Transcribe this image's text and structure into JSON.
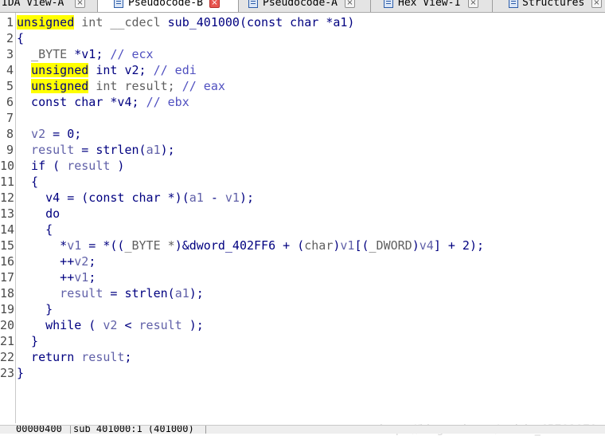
{
  "tabs": [
    {
      "label": "IDA View-A",
      "icon": "none",
      "close": "×",
      "active": false
    },
    {
      "label": "Pseudocode-B",
      "icon": "pseudocode-icon",
      "close": "×",
      "active": true
    },
    {
      "label": "Pseudocode-A",
      "icon": "pseudocode-icon",
      "close": "×",
      "active": false
    },
    {
      "label": "Hex View-1",
      "icon": "hex-icon",
      "close": "×",
      "active": false
    },
    {
      "label": "Structures",
      "icon": "struct-icon",
      "close": "×",
      "active": false
    }
  ],
  "code": {
    "lines": [
      {
        "n": "1",
        "tokens": [
          [
            "hl",
            "unsigned"
          ],
          [
            "typ",
            " int __cdecl "
          ],
          [
            "def",
            "sub_401000(const char *a1)"
          ]
        ]
      },
      {
        "n": "2",
        "tokens": [
          [
            "kw",
            "{"
          ]
        ]
      },
      {
        "n": "3",
        "tokens": [
          [
            "typ",
            "  _BYTE "
          ],
          [
            "kw",
            "*v1; "
          ],
          [
            "com",
            "// ecx"
          ]
        ]
      },
      {
        "n": "4",
        "tokens": [
          [
            "kw",
            "  "
          ],
          [
            "hl",
            "unsigned"
          ],
          [
            "kw",
            " int v2; "
          ],
          [
            "com",
            "// edi"
          ]
        ]
      },
      {
        "n": "5",
        "tokens": [
          [
            "kw",
            "  "
          ],
          [
            "hl",
            "unsigned"
          ],
          [
            "typ",
            " int result; "
          ],
          [
            "com",
            "// eax"
          ]
        ]
      },
      {
        "n": "6",
        "tokens": [
          [
            "kw",
            "  const char *v4; "
          ],
          [
            "com",
            "// ebx"
          ]
        ]
      },
      {
        "n": "7",
        "tokens": []
      },
      {
        "n": "8",
        "tokens": [
          [
            "var",
            "  v2"
          ],
          [
            "kw",
            " = 0;"
          ]
        ]
      },
      {
        "n": "9",
        "tokens": [
          [
            "var",
            "  result"
          ],
          [
            "kw",
            " = strlen("
          ],
          [
            "var",
            "a1"
          ],
          [
            "kw",
            ");"
          ]
        ]
      },
      {
        "n": "10",
        "tokens": [
          [
            "kw",
            "  if ( "
          ],
          [
            "var",
            "result"
          ],
          [
            "kw",
            " )"
          ]
        ]
      },
      {
        "n": "11",
        "tokens": [
          [
            "kw",
            "  {"
          ]
        ]
      },
      {
        "n": "12",
        "tokens": [
          [
            "kw",
            "    v4 = (const char *)("
          ],
          [
            "var",
            "a1"
          ],
          [
            "kw",
            " - "
          ],
          [
            "var",
            "v1"
          ],
          [
            "kw",
            ");"
          ]
        ]
      },
      {
        "n": "13",
        "tokens": [
          [
            "kw",
            "    do"
          ]
        ]
      },
      {
        "n": "14",
        "tokens": [
          [
            "kw",
            "    {"
          ]
        ]
      },
      {
        "n": "15",
        "tokens": [
          [
            "kw",
            "      *"
          ],
          [
            "var",
            "v1"
          ],
          [
            "kw",
            " = *(("
          ],
          [
            "typ",
            "_BYTE *"
          ],
          [
            "kw",
            ")&dword_402FF6 + ("
          ],
          [
            "typ",
            "char"
          ],
          [
            "kw",
            ")"
          ],
          [
            "var",
            "v1"
          ],
          [
            "kw",
            "[("
          ],
          [
            "typ",
            "_DWORD"
          ],
          [
            "kw",
            ")"
          ],
          [
            "var",
            "v4"
          ],
          [
            "kw",
            "] + 2);"
          ]
        ]
      },
      {
        "n": "16",
        "tokens": [
          [
            "kw",
            "      ++"
          ],
          [
            "var",
            "v2"
          ],
          [
            "kw",
            ";"
          ]
        ]
      },
      {
        "n": "17",
        "tokens": [
          [
            "kw",
            "      ++"
          ],
          [
            "var",
            "v1"
          ],
          [
            "kw",
            ";"
          ]
        ]
      },
      {
        "n": "18",
        "tokens": [
          [
            "var",
            "      result"
          ],
          [
            "kw",
            " = strlen("
          ],
          [
            "var",
            "a1"
          ],
          [
            "kw",
            ");"
          ]
        ]
      },
      {
        "n": "19",
        "tokens": [
          [
            "kw",
            "    }"
          ]
        ]
      },
      {
        "n": "20",
        "tokens": [
          [
            "kw",
            "    while ( "
          ],
          [
            "var",
            "v2"
          ],
          [
            "kw",
            " < "
          ],
          [
            "var",
            "result"
          ],
          [
            "kw",
            " );"
          ]
        ]
      },
      {
        "n": "21",
        "tokens": [
          [
            "kw",
            "  }"
          ]
        ]
      },
      {
        "n": "22",
        "tokens": [
          [
            "kw",
            "  return "
          ],
          [
            "var",
            "result"
          ],
          [
            "kw",
            ";"
          ]
        ]
      },
      {
        "n": "23",
        "tokens": [
          [
            "kw",
            "}"
          ]
        ]
      }
    ]
  },
  "status": {
    "address": "00000400",
    "function": "sub_401000:1 (401000)"
  },
  "watermark": "https://blog.csdn.net/weixin_45701079"
}
